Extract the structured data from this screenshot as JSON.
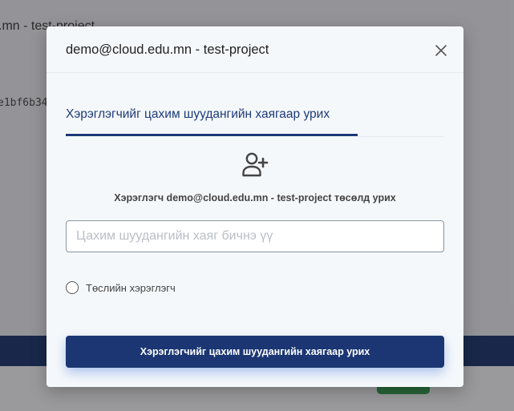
{
  "background": {
    "title_fragment": ".mn - test-project",
    "hash_fragment": "e1bf6b34"
  },
  "modal": {
    "title": "demo@cloud.edu.mn - test-project",
    "close_icon": "close-icon",
    "tab_label": "Хэрэглэгчийг цахим шуудангийн хаягаар урих",
    "user_icon": "user-plus-icon",
    "description": "Хэрэглэгч demo@cloud.edu.mn - test-project төсөлд урих",
    "email_input": {
      "value": "",
      "placeholder": "Цахим шуудангийн хаяг бичнэ үү"
    },
    "project_user_option": {
      "label": "Төслийн хэрэглэгч",
      "checked": false
    },
    "submit_label": "Хэрэглэгчийг цахим шуудангийн хаягаар урих"
  },
  "colors": {
    "accent": "#1d3a78",
    "button": "#1b3672",
    "modal_bg": "#f5f8fb"
  }
}
